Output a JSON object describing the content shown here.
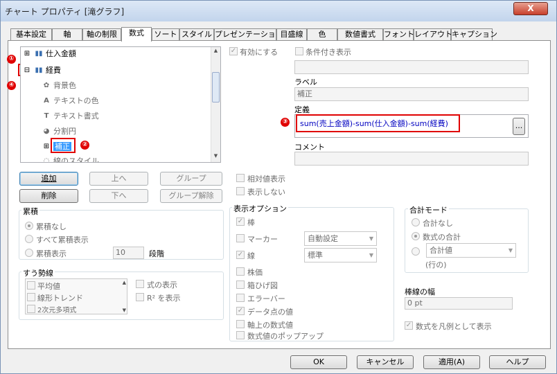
{
  "window": {
    "title": "チャート プロパティ [滝グラフ]",
    "close_label": "X"
  },
  "tabs": [
    "基本設定",
    "軸",
    "軸の制限",
    "数式",
    "ソート",
    "スタイル",
    "プレゼンテーション",
    "目盛線",
    "色",
    "数値書式",
    "フォント",
    "レイアウト",
    "キャプション"
  ],
  "tree": {
    "item1": "仕入金額",
    "item2": "経費",
    "sub": [
      "背景色",
      "テキストの色",
      "テキスト書式",
      "分割円",
      "補正",
      "線のスタイル"
    ],
    "expand_symbol": "⊞",
    "collapse_symbol": "⊟"
  },
  "buttons": {
    "add": "追加",
    "up": "上へ",
    "group": "グループ",
    "delete": "削除",
    "down": "下へ",
    "ungroup": "グループ解除"
  },
  "right": {
    "enabled": "有効にする",
    "conditional": "条件付き表示",
    "label_title": "ラベル",
    "label_value": "補正",
    "definition_title": "定義",
    "definition_value": "sum(売上金額)-sum(仕入金額)-sum(経費)",
    "definition_btn": "...",
    "comment_title": "コメント"
  },
  "cumulative": {
    "title": "累積",
    "none": "累積なし",
    "all": "すべて累積表示",
    "show": "累積表示",
    "steps_value": "10",
    "steps_label": "段階"
  },
  "trend": {
    "title": "すう勢線",
    "items": [
      "平均値",
      "線形トレンド",
      "2次元多項式"
    ],
    "show_formula": "式の表示",
    "show_r2": "R² を表示"
  },
  "middle": {
    "relative": "相対値表示",
    "hide": "表示しない"
  },
  "display": {
    "title": "表示オプション",
    "bar": "棒",
    "marker": "マーカー",
    "line": "線",
    "candle": "株価",
    "box": "箱ひげ図",
    "errorbar": "エラーバー",
    "values": "データ点の値",
    "axis_values": "軸上の数式値",
    "popup": "数式値のポップアップ",
    "marker_combo": "自動設定",
    "line_combo": "標準"
  },
  "total": {
    "title": "合計モード",
    "none": "合計なし",
    "expr": "数式の合計",
    "combo": "合計値",
    "rows": "(行の)"
  },
  "linewidth": {
    "title": "棒線の幅",
    "value": "0 pt"
  },
  "legend": "数式を凡例として表示",
  "footer": {
    "ok": "OK",
    "cancel": "キャンセル",
    "apply": "適用(A)",
    "help": "ヘルプ"
  },
  "markers": {
    "m1": "①",
    "m2": "②",
    "m3": "③",
    "m4": "④"
  },
  "colors": {
    "accent": "#e00000",
    "select": "#3399ff",
    "formula_blue": "#0000c0",
    "formula_red": "#9b0000"
  }
}
